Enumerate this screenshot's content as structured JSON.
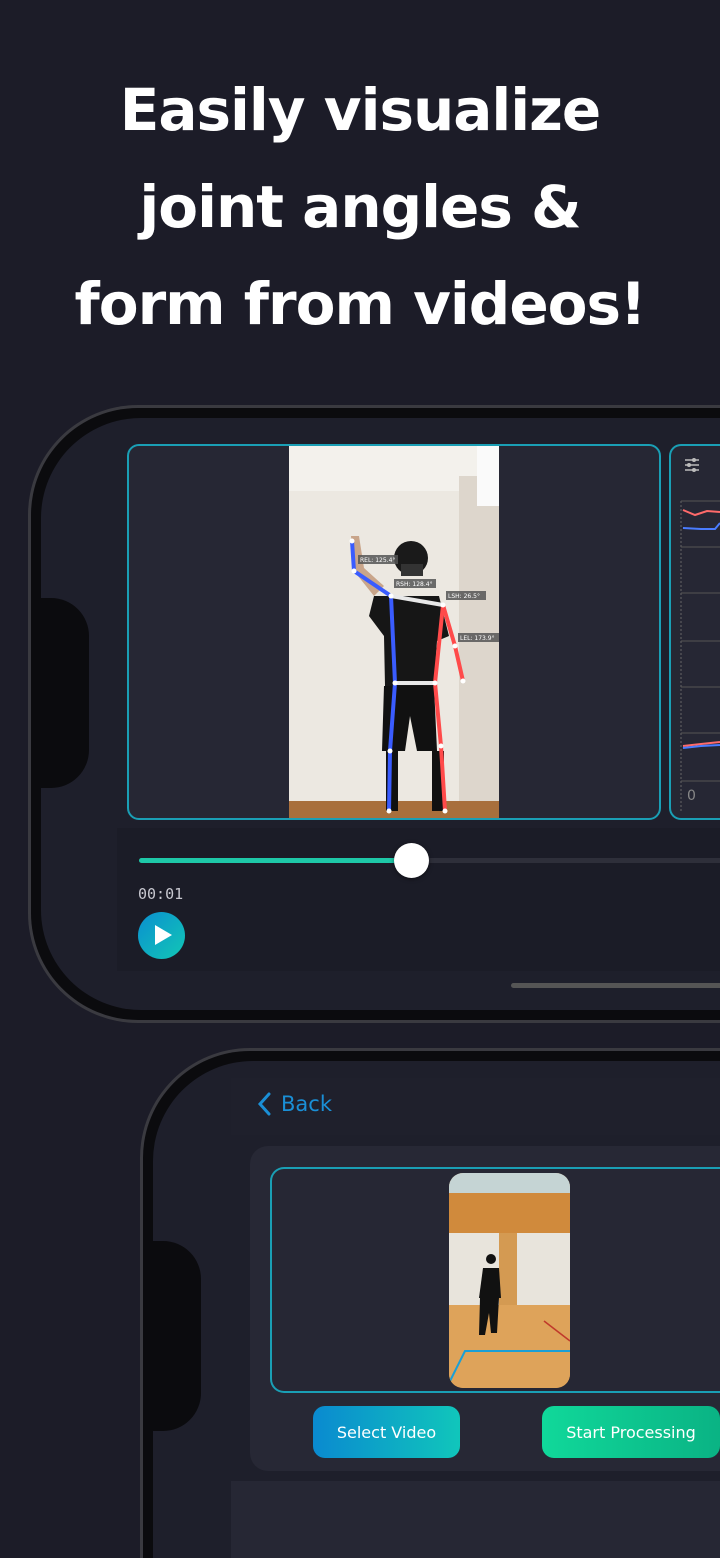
{
  "headline": [
    "Easily visualize",
    "joint angles &",
    "form from videos!"
  ],
  "player": {
    "joint_labels": {
      "rel": "REL: 125.4°",
      "rsh": "RSH: 128.4°",
      "lsh": "LSH: 26.5°",
      "lel": "LEL: 173.9°"
    },
    "chart_axis_zero": "0",
    "time": "00:01",
    "progress_fraction": 0.4,
    "play_icon": "play-icon",
    "filter_icon": "sliders-icon"
  },
  "upload": {
    "back_label": "Back",
    "select_video_label": "Select Video",
    "start_processing_label": "Start Processing"
  },
  "colors": {
    "accent": "#1a9fb5",
    "slider": "#1ec8a8",
    "back": "#1a8fd6",
    "left_side": "#3a5cff",
    "right_side": "#ff4a4a"
  }
}
